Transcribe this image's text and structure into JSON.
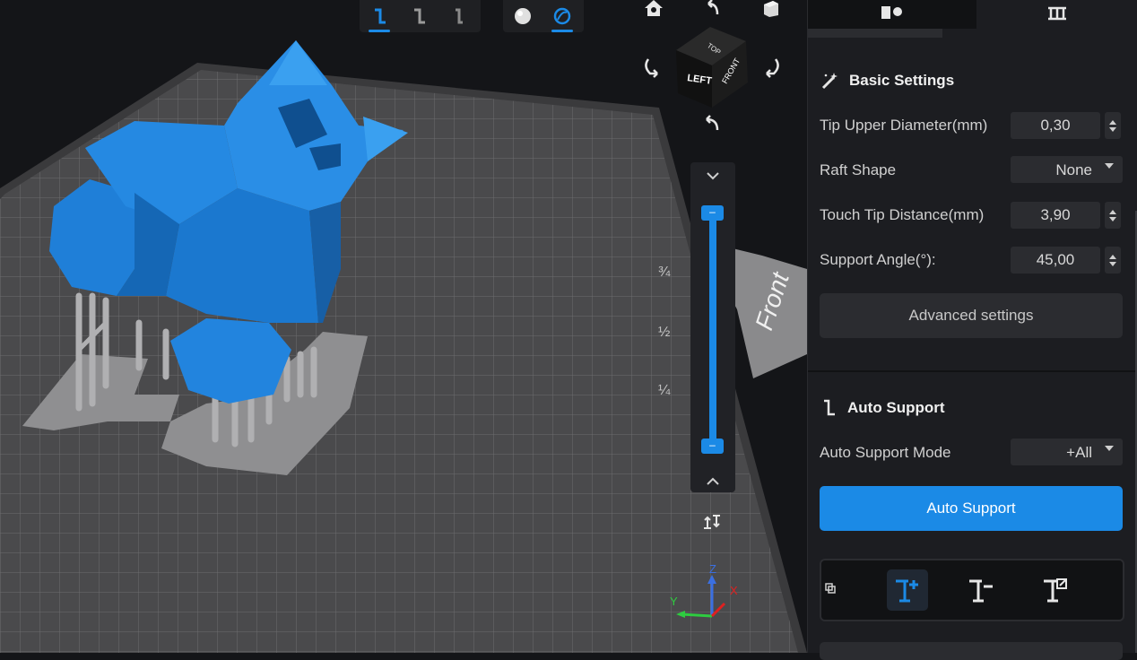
{
  "viewport": {
    "top_toolbar": {
      "support_buttons": [
        "support-tool-1",
        "support-tool-2",
        "support-tool-3"
      ],
      "view_buttons": [
        "solid-view",
        "xray-view"
      ]
    },
    "view_cube": {
      "top": "TOP",
      "left": "LEFT",
      "front": "FRONT"
    },
    "platform_label": "Front",
    "slider": {
      "marks": [
        "¾",
        "½",
        "¼"
      ],
      "handle_label": "–",
      "upper_level": 1.0,
      "lower_level": 0.0
    },
    "axes": {
      "x": "X",
      "y": "Y",
      "z": "Z"
    },
    "colors": {
      "model": "#1876d2",
      "accent": "#1b8ae6"
    }
  },
  "panel": {
    "basic_settings": {
      "title": "Basic Settings",
      "tip_upper_diameter": {
        "label": "Tip Upper Diameter(mm)",
        "value": "0,30"
      },
      "raft_shape": {
        "label": "Raft Shape",
        "value": "None"
      },
      "touch_tip_distance": {
        "label": "Touch Tip Distance(mm)",
        "value": "3,90"
      },
      "support_angle": {
        "label": "Support Angle(°):",
        "value": "45,00"
      },
      "advanced_button": "Advanced settings"
    },
    "auto_support": {
      "title": "Auto Support",
      "mode": {
        "label": "Auto Support Mode",
        "value": "+All"
      },
      "button": "Auto Support"
    }
  }
}
